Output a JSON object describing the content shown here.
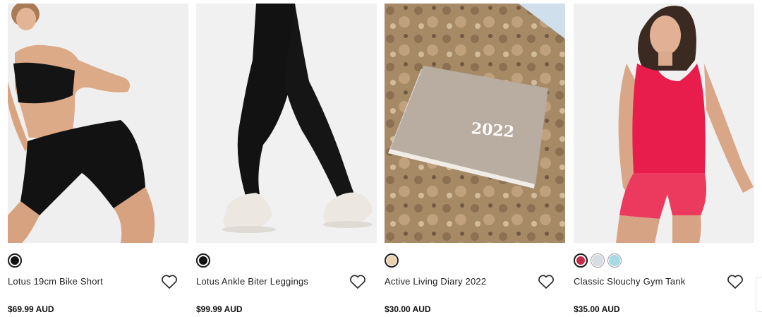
{
  "products": [
    {
      "name": "Lotus 19cm Bike Short",
      "price": "$69.99 AUD",
      "image_alt": "model-in-black-bike-shorts",
      "swatches": [
        "#111111"
      ]
    },
    {
      "name": "Lotus Ankle Biter Leggings",
      "price": "$99.99 AUD",
      "image_alt": "black-leggings-and-sneakers",
      "swatches": [
        "#111111"
      ]
    },
    {
      "name": "Active Living Diary 2022",
      "price": "$30.00 AUD",
      "image_alt": "linen-diary-on-stone",
      "image_text": "2022",
      "swatches": [
        "#ead0ad"
      ]
    },
    {
      "name": "Classic Slouchy Gym Tank",
      "price": "$35.00 AUD",
      "image_alt": "model-in-red-tank",
      "swatches": [
        "#c82a4a",
        "#d7dde3",
        "#a6dbe6"
      ]
    }
  ],
  "icons": {
    "wishlist": "heart-outline-icon"
  },
  "colors": {
    "text": "#222222",
    "price": "#111111",
    "card_bg": "#f0f0f0"
  }
}
